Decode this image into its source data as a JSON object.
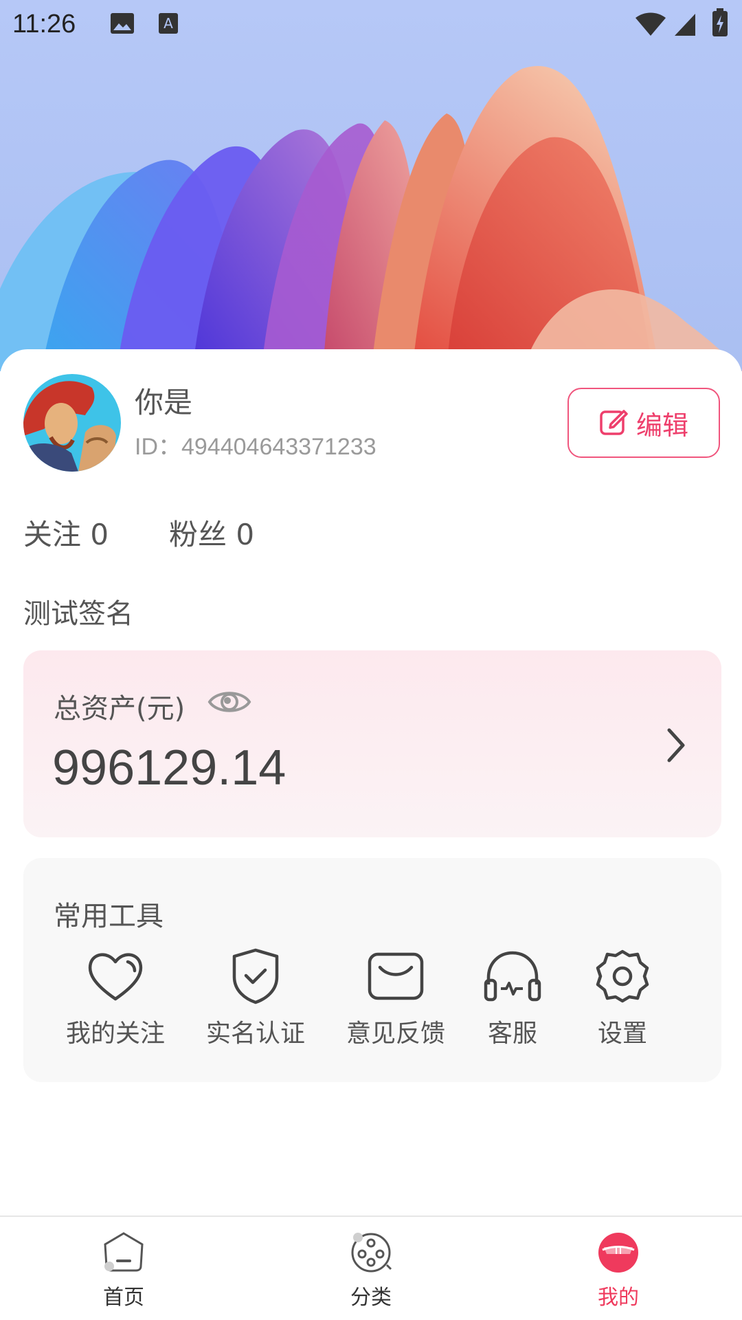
{
  "status_bar": {
    "time": "11:26",
    "icons": [
      "image-icon",
      "keyboard-a-icon",
      "wifi-icon",
      "signal-icon",
      "battery-charging-icon"
    ]
  },
  "profile": {
    "username": "你是",
    "id_text": "ID：494404643371233",
    "edit_label": "编辑",
    "following": "关注 0",
    "followers": "粉丝 0",
    "signature": "测试签名"
  },
  "assets": {
    "title": "总资产(元)",
    "value": "996129.14"
  },
  "tools": {
    "title": "常用工具",
    "items": [
      {
        "label": "我的关注",
        "icon": "heart-icon"
      },
      {
        "label": "实名认证",
        "icon": "shield-check-icon"
      },
      {
        "label": "意见反馈",
        "icon": "message-box-icon"
      },
      {
        "label": "客服",
        "icon": "headset-icon"
      },
      {
        "label": "设置",
        "icon": "gear-icon"
      }
    ]
  },
  "tabbar": {
    "items": [
      {
        "label": "首页",
        "icon": "home-icon",
        "active": false
      },
      {
        "label": "分类",
        "icon": "film-reel-icon",
        "active": false
      },
      {
        "label": "我的",
        "icon": "profile-icon",
        "active": true
      }
    ],
    "active_color": "#ef3a5d"
  },
  "colors": {
    "accent": "#ee3f6c",
    "hero_bg": "#b1c5f6"
  }
}
